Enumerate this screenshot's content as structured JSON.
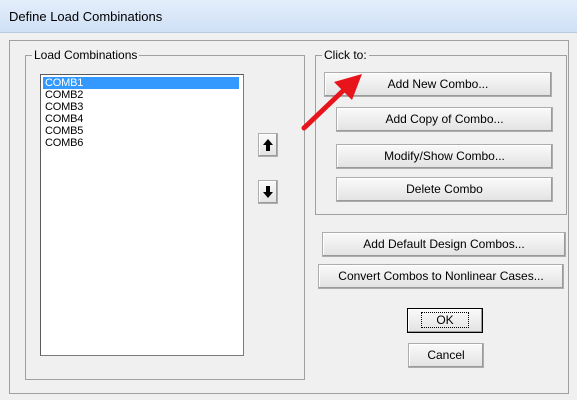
{
  "window": {
    "title": "Define Load Combinations"
  },
  "load_combinations": {
    "label": "Load Combinations",
    "items": [
      "COMB1",
      "COMB2",
      "COMB3",
      "COMB4",
      "COMB5",
      "COMB6"
    ],
    "selected_index": 0
  },
  "move_buttons": {
    "up_icon": "arrow-up-icon",
    "down_icon": "arrow-down-icon"
  },
  "click_to": {
    "label": "Click to:",
    "add_new": "Add New Combo...",
    "add_copy": "Add Copy of Combo...",
    "modify_show": "Modify/Show Combo...",
    "delete": "Delete Combo"
  },
  "extra_buttons": {
    "add_default_design": "Add Default Design Combos...",
    "convert_nonlinear": "Convert Combos to Nonlinear Cases..."
  },
  "dialog_buttons": {
    "ok": "OK",
    "cancel": "Cancel"
  },
  "annotation": {
    "arrow_color": "#e8141b"
  },
  "colors": {
    "selection": "#3399ff",
    "titlebar": "#d6e5f7"
  }
}
